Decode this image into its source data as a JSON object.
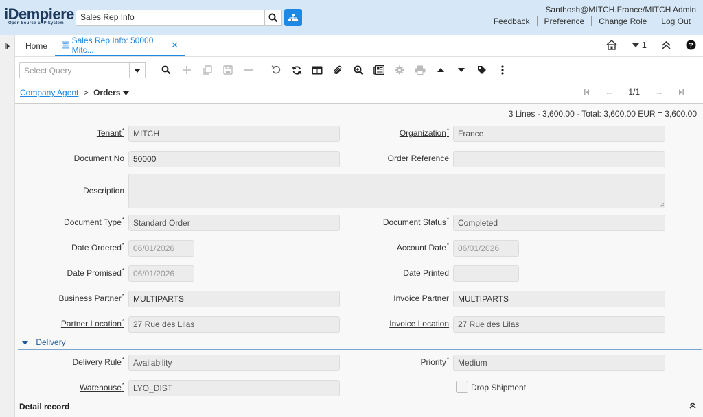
{
  "header": {
    "logo_text": "iDempiere",
    "logo_sub": "Open Source ERP System",
    "search_value": "Sales Rep Info",
    "user": "Santhosh@MITCH.France/MITCH Admin",
    "links": [
      "Feedback",
      "Preference",
      "Change Role",
      "Log Out"
    ]
  },
  "tabs": {
    "home": "Home",
    "active": "Sales Rep Info: 50000 Mitc...",
    "count": "1"
  },
  "toolbar": {
    "query_placeholder": "Select Query"
  },
  "breadcrumb": {
    "parent": "Company Agent",
    "separator": ">",
    "current": "Orders"
  },
  "nav": {
    "record": "1/1"
  },
  "summary": "3 Lines - 3,600.00 - Total: 3,600.00 EUR = 3,600.00",
  "fields": {
    "tenant_label": "Tenant",
    "tenant": "MITCH",
    "org_label": "Organization",
    "org": "France",
    "docno_label": "Document No",
    "docno": "50000",
    "orderref_label": "Order Reference",
    "orderref": "",
    "desc_label": "Description",
    "desc": "",
    "doctype_label": "Document Type",
    "doctype": "Standard Order",
    "docstatus_label": "Document Status",
    "docstatus": "Completed",
    "dateordered_label": "Date Ordered",
    "dateordered": "06/01/2026",
    "acctdate_label": "Account Date",
    "acctdate": "06/01/2026",
    "datepromised_label": "Date Promised",
    "datepromised": "06/01/2026",
    "dateprinted_label": "Date Printed",
    "dateprinted": "",
    "bp_label": "Business Partner",
    "bp": "MULTIPARTS",
    "invpartner_label": "Invoice Partner",
    "invpartner": "MULTIPARTS",
    "partnerloc_label": "Partner Location",
    "partnerloc": "27 Rue des Lilas",
    "invloc_label": "Invoice Location",
    "invloc": "27 Rue des Lilas"
  },
  "delivery": {
    "section": "Delivery",
    "rule_label": "Delivery Rule",
    "rule": "Availability",
    "priority_label": "Priority",
    "priority": "Medium",
    "warehouse_label": "Warehouse",
    "warehouse": "LYO_DIST",
    "dropship_label": "Drop Shipment"
  },
  "detail": "Detail record"
}
